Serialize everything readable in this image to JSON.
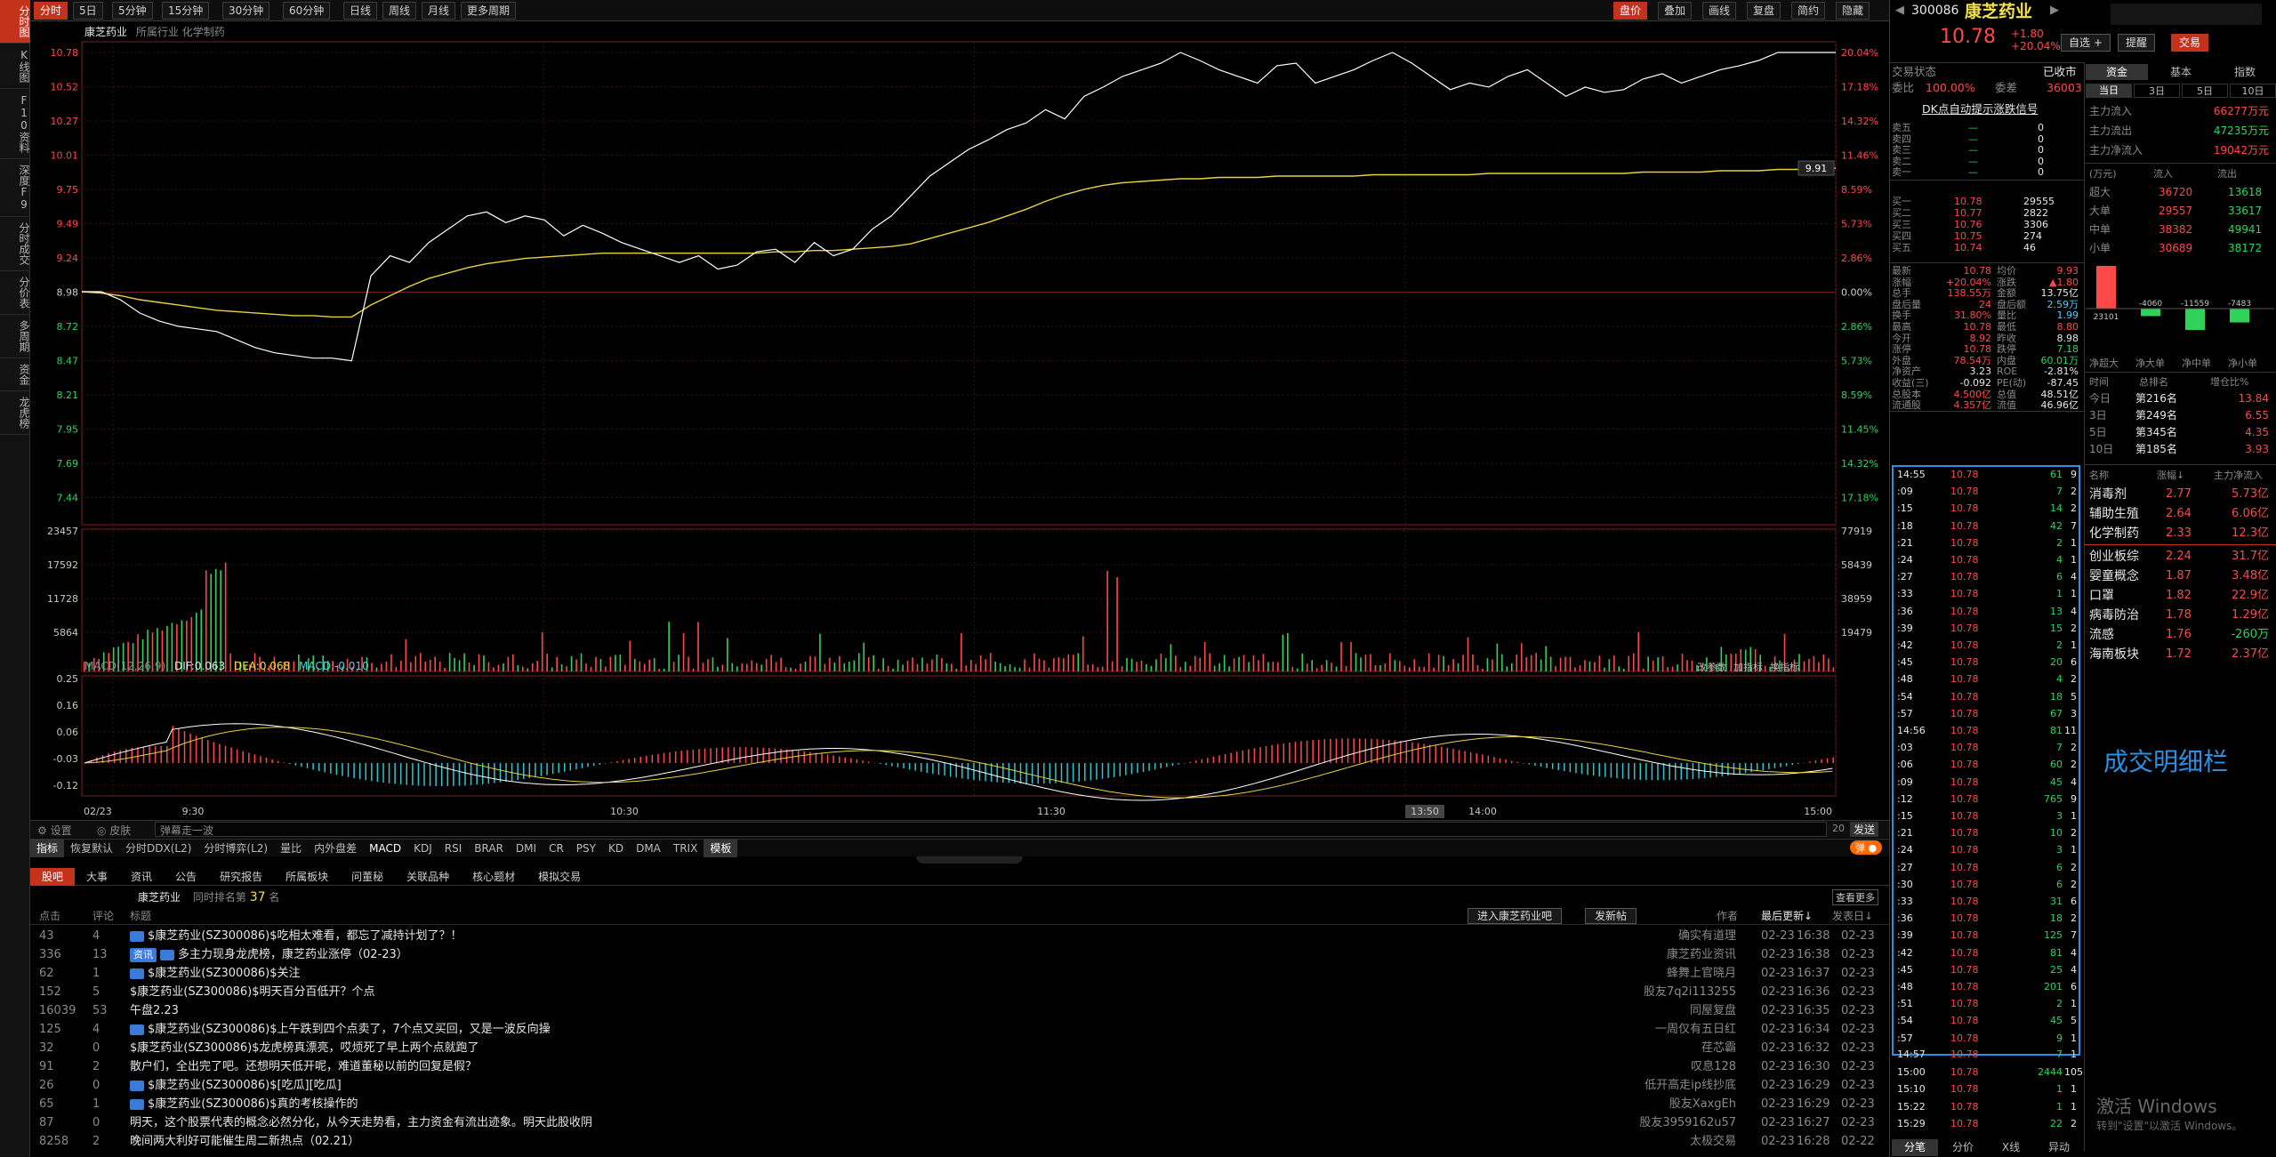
{
  "leftbar": [
    {
      "label": "分时图",
      "active": true
    },
    {
      "label": "K线图",
      "active": false
    },
    {
      "label": "F10资料",
      "active": false
    },
    {
      "label": "深度F9",
      "active": false
    },
    {
      "label": "分时成交",
      "active": false
    },
    {
      "label": "分价表",
      "active": false
    },
    {
      "label": "多周期",
      "active": false
    },
    {
      "label": "资金",
      "active": false
    },
    {
      "label": "龙虎榜",
      "active": false
    }
  ],
  "topbar": {
    "periods": [
      "分时",
      "5日",
      "5分钟",
      "15分钟",
      "30分钟",
      "60分钟",
      "日线",
      "周线",
      "月线",
      "更多周期"
    ],
    "right_buttons": [
      "盘价",
      "叠加",
      "画线",
      "复盘",
      "简约",
      "隐藏"
    ]
  },
  "chart": {
    "stock_label": "康芝药业",
    "industry_label": "所属行业",
    "industry": "化学制药",
    "price_ticks": [
      "10.78",
      "10.52",
      "10.27",
      "10.01",
      "9.75",
      "9.49",
      "9.24",
      "8.98",
      "8.72",
      "8.47",
      "8.21",
      "7.95",
      "7.69",
      "7.44"
    ],
    "pct_ticks": [
      "20.04%",
      "17.18%",
      "14.32%",
      "11.46%",
      "8.59%",
      "5.73%",
      "2.86%",
      "0.00%",
      "2.86%",
      "5.73%",
      "8.59%",
      "11.45%",
      "14.32%",
      "17.18%"
    ],
    "current_price_tag": "9.91",
    "volume_ticks_left": [
      "23457",
      "17592",
      "11728",
      "5864"
    ],
    "volume_ticks_right": [
      "77919",
      "58439",
      "38959",
      "19479"
    ],
    "macd_label": "MACD(12,26,9)",
    "dif": "DIF:0.063",
    "dea": "DEA:0.068",
    "macd": "MACD:-0.010",
    "macd_ticks": [
      "0.25",
      "0.16",
      "0.06",
      "-0.03",
      "-0.12"
    ],
    "indicator_btns": [
      "改参数",
      "加指标",
      "换指标"
    ],
    "time_labels": [
      "02/23",
      "9:30",
      "10:30",
      "11:30",
      "13:50",
      "14:00",
      "15:00"
    ],
    "price_series": [
      8.98,
      8.98,
      8.92,
      8.82,
      8.76,
      8.72,
      8.7,
      8.68,
      8.62,
      8.56,
      8.52,
      8.5,
      8.48,
      8.48,
      8.46,
      9.1,
      9.25,
      9.2,
      9.35,
      9.45,
      9.55,
      9.58,
      9.5,
      9.55,
      9.52,
      9.4,
      9.48,
      9.42,
      9.35,
      9.3,
      9.25,
      9.2,
      9.25,
      9.15,
      9.18,
      9.28,
      9.3,
      9.2,
      9.35,
      9.25,
      9.3,
      9.45,
      9.55,
      9.7,
      9.85,
      9.95,
      10.05,
      10.12,
      10.2,
      10.25,
      10.35,
      10.28,
      10.45,
      10.52,
      10.6,
      10.65,
      10.7,
      10.78,
      10.72,
      10.65,
      10.6,
      10.55,
      10.68,
      10.7,
      10.55,
      10.6,
      10.65,
      10.72,
      10.78,
      10.7,
      10.6,
      10.5,
      10.55,
      10.52,
      10.6,
      10.65,
      10.55,
      10.45,
      10.52,
      10.48,
      10.5,
      10.58,
      10.62,
      10.55,
      10.6,
      10.65,
      10.68,
      10.72,
      10.78,
      10.78,
      10.78,
      10.78
    ],
    "avg_series": [
      8.98,
      8.97,
      8.95,
      8.92,
      8.9,
      8.88,
      8.86,
      8.84,
      8.83,
      8.82,
      8.81,
      8.8,
      8.8,
      8.79,
      8.79,
      8.88,
      8.95,
      9.02,
      9.08,
      9.12,
      9.16,
      9.19,
      9.21,
      9.23,
      9.24,
      9.25,
      9.26,
      9.27,
      9.27,
      9.27,
      9.27,
      9.27,
      9.27,
      9.27,
      9.27,
      9.27,
      9.28,
      9.28,
      9.29,
      9.29,
      9.3,
      9.31,
      9.32,
      9.34,
      9.38,
      9.42,
      9.46,
      9.5,
      9.55,
      9.6,
      9.66,
      9.71,
      9.75,
      9.78,
      9.8,
      9.81,
      9.82,
      9.83,
      9.83,
      9.84,
      9.84,
      9.84,
      9.85,
      9.85,
      9.85,
      9.85,
      9.85,
      9.86,
      9.86,
      9.86,
      9.86,
      9.86,
      9.86,
      9.87,
      9.87,
      9.87,
      9.87,
      9.87,
      9.87,
      9.87,
      9.87,
      9.88,
      9.88,
      9.88,
      9.88,
      9.89,
      9.89,
      9.89,
      9.9,
      9.9,
      9.91,
      9.91
    ]
  },
  "right": {
    "code": "300086",
    "name": "康芝药业",
    "price": "10.78",
    "change": "+1.80",
    "change_pct": "+20.04%",
    "buttons": [
      "自选 +",
      "提醒",
      "交易"
    ],
    "trade_status_label": "交易状态",
    "trade_status": "已收市",
    "weibi_label": "委比",
    "weibi": "100.00%",
    "weicha_label": "委差",
    "weicha": "36003",
    "ddx_link": "DK点自动提示涨跌信号",
    "sell_levels": [
      {
        "label": "卖五",
        "price": "—",
        "vol": "0"
      },
      {
        "label": "卖四",
        "price": "—",
        "vol": "0"
      },
      {
        "label": "卖三",
        "price": "—",
        "vol": "0"
      },
      {
        "label": "卖二",
        "price": "—",
        "vol": "0"
      },
      {
        "label": "卖一",
        "price": "—",
        "vol": "0"
      }
    ],
    "buy_levels": [
      {
        "label": "买一",
        "price": "10.78",
        "vol": "29555"
      },
      {
        "label": "买二",
        "price": "10.77",
        "vol": "2822"
      },
      {
        "label": "买三",
        "price": "10.76",
        "vol": "3306"
      },
      {
        "label": "买四",
        "price": "10.75",
        "vol": "274"
      },
      {
        "label": "买五",
        "price": "10.74",
        "vol": "46"
      }
    ],
    "stats": [
      [
        "最新",
        "10.78",
        "均价",
        "9.93"
      ],
      [
        "涨幅",
        "+20.04%",
        "涨跌",
        "▲1.80"
      ],
      [
        "总手",
        "138.55万",
        "金额",
        "13.75亿"
      ],
      [
        "盘后量",
        "24",
        "盘后额",
        "2.59万"
      ],
      [
        "换手",
        "31.80%",
        "量比",
        "1.99"
      ],
      [
        "最高",
        "10.78",
        "最低",
        "8.80"
      ],
      [
        "今开",
        "8.92",
        "昨收",
        "8.98"
      ],
      [
        "涨停",
        "10.78",
        "跌停",
        "7.18"
      ],
      [
        "外盘",
        "78.54万",
        "内盘",
        "60.01万"
      ],
      [
        "净资产",
        "3.23",
        "ROE",
        "-2.81%"
      ],
      [
        "收益(三)",
        "-0.092",
        "PE(动)",
        "-87.45"
      ],
      [
        "总股本",
        "4.500亿",
        "总值",
        "48.51亿"
      ],
      [
        "流通股",
        "4.357亿",
        "流值",
        "46.96亿"
      ]
    ],
    "ticks": [
      [
        "14:55",
        "10.78",
        "61",
        "9"
      ],
      [
        ":09",
        "10.78",
        "7",
        "2"
      ],
      [
        ":15",
        "10.78",
        "14",
        "2"
      ],
      [
        ":18",
        "10.78",
        "42",
        "7"
      ],
      [
        ":21",
        "10.78",
        "2",
        "1"
      ],
      [
        ":24",
        "10.78",
        "4",
        "1"
      ],
      [
        ":27",
        "10.78",
        "6",
        "4"
      ],
      [
        ":33",
        "10.78",
        "1",
        "1"
      ],
      [
        ":36",
        "10.78",
        "13",
        "4"
      ],
      [
        ":39",
        "10.78",
        "15",
        "2"
      ],
      [
        ":42",
        "10.78",
        "2",
        "1"
      ],
      [
        ":45",
        "10.78",
        "20",
        "6"
      ],
      [
        ":48",
        "10.78",
        "4",
        "2"
      ],
      [
        ":54",
        "10.78",
        "18",
        "5"
      ],
      [
        ":57",
        "10.78",
        "67",
        "3"
      ],
      [
        "14:56",
        "10.78",
        "81",
        "11"
      ],
      [
        ":03",
        "10.78",
        "7",
        "2"
      ],
      [
        ":06",
        "10.78",
        "60",
        "2"
      ],
      [
        ":09",
        "10.78",
        "45",
        "4"
      ],
      [
        ":12",
        "10.78",
        "765",
        "9"
      ],
      [
        ":15",
        "10.78",
        "3",
        "1"
      ],
      [
        ":21",
        "10.78",
        "10",
        "2"
      ],
      [
        ":24",
        "10.78",
        "3",
        "1"
      ],
      [
        ":27",
        "10.78",
        "6",
        "2"
      ],
      [
        ":30",
        "10.78",
        "6",
        "2"
      ],
      [
        ":33",
        "10.78",
        "31",
        "6"
      ],
      [
        ":36",
        "10.78",
        "18",
        "2"
      ],
      [
        ":39",
        "10.78",
        "125",
        "7"
      ],
      [
        ":42",
        "10.78",
        "81",
        "4"
      ],
      [
        ":45",
        "10.78",
        "25",
        "4"
      ],
      [
        ":48",
        "10.78",
        "201",
        "6"
      ],
      [
        ":51",
        "10.78",
        "2",
        "1"
      ],
      [
        ":54",
        "10.78",
        "45",
        "5"
      ],
      [
        ":57",
        "10.78",
        "9",
        "1"
      ],
      [
        "14:57",
        "10.78",
        "7",
        "1"
      ],
      [
        "15:00",
        "10.78",
        "2444",
        "105"
      ],
      [
        "15:10",
        "10.78",
        "1",
        "1"
      ],
      [
        "15:22",
        "10.78",
        "1",
        "1"
      ],
      [
        "15:29",
        "10.78",
        "22",
        "2"
      ]
    ],
    "ticks_annotation": "成交明细栏",
    "fund_tabs": [
      "资金",
      "基本",
      "指数"
    ],
    "period_tabs": [
      "当日",
      "3日",
      "5日",
      "10日"
    ],
    "main_flow": [
      [
        "主力流入",
        "66277万元"
      ],
      [
        "主力流出",
        "47235万元"
      ],
      [
        "主力净流入",
        "19042万元"
      ]
    ],
    "flow_header": [
      "(万元)",
      "流入",
      "流出"
    ],
    "flow_rows": [
      [
        "超大",
        "36720",
        "13618"
      ],
      [
        "大单",
        "29557",
        "33617"
      ],
      [
        "中单",
        "38382",
        "49941"
      ],
      [
        "小单",
        "30689",
        "38172"
      ]
    ],
    "net_bars": {
      "values": [
        23101,
        -4060,
        -11559,
        -7483
      ],
      "labels": [
        "23101",
        "-4060",
        "-11559",
        "-7483"
      ]
    },
    "net_bar_categories": [
      "净超大",
      "净大单",
      "净中单",
      "净小单"
    ],
    "rank_header": [
      "时间",
      "总排名",
      "增仓比%"
    ],
    "rank_rows": [
      [
        "今日",
        "第216名",
        "13.84"
      ],
      [
        "3日",
        "第249名",
        "6.55"
      ],
      [
        "5日",
        "第345名",
        "4.35"
      ],
      [
        "10日",
        "第185名",
        "3.93"
      ]
    ],
    "sector_header": [
      "名称",
      "涨幅↓",
      "主力净流入"
    ],
    "sectors": [
      [
        "消毒剂",
        "2.77",
        "5.73亿"
      ],
      [
        "辅助生殖",
        "2.64",
        "6.06亿"
      ],
      [
        "化学制药",
        "2.33",
        "12.3亿"
      ],
      [
        "创业板综",
        "2.24",
        "31.7亿"
      ],
      [
        "婴童概念",
        "1.87",
        "3.48亿"
      ],
      [
        "口罩",
        "1.82",
        "22.9亿"
      ],
      [
        "病毒防治",
        "1.78",
        "1.29亿"
      ],
      [
        "流感",
        "1.76",
        "-260万"
      ],
      [
        "海南板块",
        "1.72",
        "2.37亿"
      ]
    ],
    "bottom_tabs": [
      "分笔",
      "分价",
      "X线",
      "异动"
    ],
    "windows_watermark": "激活 Windows",
    "windows_sub": "转到\"设置\"以激活 Windows。"
  },
  "lower": {
    "settings": "设置",
    "skin": "皮肤",
    "broadcast": "弹幕走一波",
    "send": "发送",
    "count": "20",
    "danmu": "弹",
    "indicator_tabs": [
      "指标",
      "恢复默认",
      "分时DDX(L2)",
      "分时博弈(L2)",
      "量比",
      "内外盘差",
      "MACD",
      "KDJ",
      "RSI",
      "BRAR",
      "DMI",
      "CR",
      "PSY",
      "KD",
      "DMA",
      "TRIX",
      "模板"
    ],
    "news_tabs": [
      "股吧",
      "大事",
      "资讯",
      "公告",
      "研究报告",
      "所属板块",
      "问董秘",
      "关联品种",
      "核心题材",
      "模拟交易"
    ],
    "forum_name": "康芝药业",
    "hot_rank_label": "同时排名第",
    "hot_rank": "37",
    "hot_rank_unit": "名",
    "more": "查看更多",
    "enter_btn": "进入康芝药业吧",
    "post_btn": "发新帖",
    "header": [
      "点击",
      "评论",
      "标题",
      "作者",
      "最后更新↓",
      "发表日↓"
    ],
    "posts": [
      [
        "43",
        "4",
        "$康芝药业(SZ300086)$吃相太难看，都忘了减持计划了？！",
        "确实有道理",
        "02-23",
        "16:38",
        "02-23",
        true,
        ""
      ],
      [
        "336",
        "13",
        "多主力现身龙虎榜，康芝药业涨停（02-23）",
        "康芝药业资讯",
        "02-23",
        "16:38",
        "02-23",
        true,
        "资讯"
      ],
      [
        "62",
        "1",
        "$康芝药业(SZ300086)$关注",
        "蜂舞上官晓月",
        "02-23",
        "16:37",
        "02-23",
        true,
        ""
      ],
      [
        "152",
        "5",
        "$康芝药业(SZ300086)$明天百分百低开？个点",
        "股友7q2i113255",
        "02-23",
        "16:36",
        "02-23",
        false,
        ""
      ],
      [
        "16039",
        "53",
        "午盘2.23",
        "同屋复盘",
        "02-23",
        "16:35",
        "02-23",
        false,
        ""
      ],
      [
        "125",
        "4",
        "$康芝药业(SZ300086)$上午跌到四个点卖了，7个点又买回，又是一波反向操",
        "一周仅有五日红",
        "02-23",
        "16:34",
        "02-23",
        true,
        ""
      ],
      [
        "32",
        "0",
        "$康芝药业(SZ300086)$龙虎榜真漂亮，哎烦死了早上两个点就跑了",
        "荏芯霸",
        "02-23",
        "16:32",
        "02-23",
        false,
        ""
      ],
      [
        "91",
        "2",
        "散户们，全出完了吧。还想明天低开呢，难道董秘以前的回复是假？",
        "叹息128",
        "02-23",
        "16:30",
        "02-23",
        false,
        ""
      ],
      [
        "26",
        "0",
        "$康芝药业(SZ300086)$[吃瓜][吃瓜]",
        "低开高走ip线抄底",
        "02-23",
        "16:29",
        "02-23",
        true,
        ""
      ],
      [
        "65",
        "1",
        "$康芝药业(SZ300086)$真的考核操作的",
        "股友XaxgEh",
        "02-23",
        "16:29",
        "02-23",
        true,
        ""
      ],
      [
        "87",
        "0",
        "明天，这个股票代表的概念必然分化，从今天走势看，主力资金有流出迹象。明天此股收阴",
        "股友3959162u57",
        "02-23",
        "16:27",
        "02-23",
        false,
        ""
      ],
      [
        "8258",
        "2",
        "晚间两大利好可能催生周二新热点（02.21）",
        "太极交易",
        "02-23",
        "16:28",
        "02-22",
        false,
        ""
      ]
    ]
  }
}
